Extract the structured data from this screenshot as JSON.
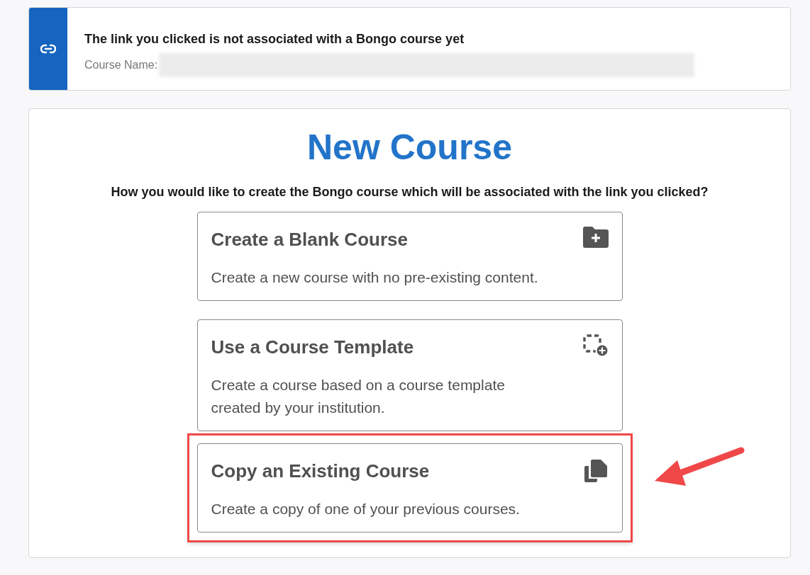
{
  "notice": {
    "title": "The link you clicked is not associated with a Bongo course yet",
    "course_name_label": "Course Name:",
    "course_name_redacted": true
  },
  "heading": "New Course",
  "question": "How you would like to create the Bongo course which will be associated with the link you clicked?",
  "options": [
    {
      "kind": "blank",
      "title": "Create a Blank Course",
      "description": "Create a new course with no pre-existing content.",
      "highlighted": false
    },
    {
      "kind": "template",
      "title": "Use a Course Template",
      "description": "Create a course based on a course template created by your institution.",
      "highlighted": false
    },
    {
      "kind": "copy",
      "title": "Copy an Existing Course",
      "description": "Create a copy of one of your previous courses.",
      "highlighted": true
    }
  ]
}
